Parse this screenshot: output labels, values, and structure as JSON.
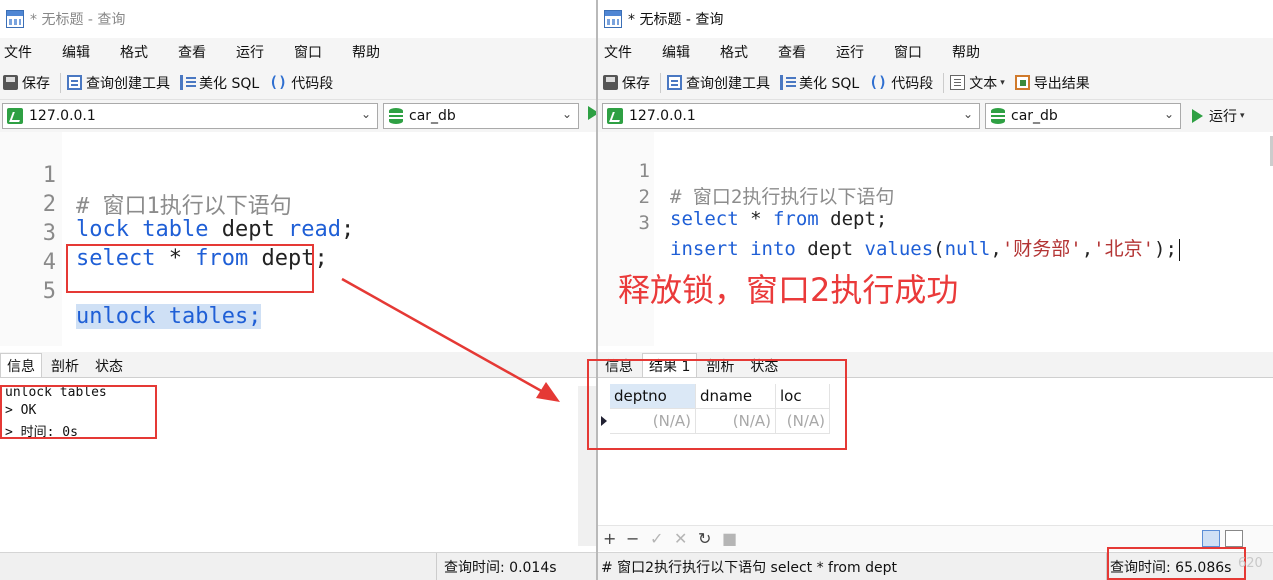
{
  "left": {
    "title": "* 无标题 - 查询",
    "menu": [
      "文件",
      "编辑",
      "格式",
      "查看",
      "运行",
      "窗口",
      "帮助"
    ],
    "toolbar": {
      "save": "保存",
      "query_builder": "查询创建工具",
      "beautify": "美化 SQL",
      "snippet_glyph": "()",
      "snippet": "代码段"
    },
    "connection": "127.0.0.1",
    "database": "car_db",
    "code_lines": [
      {
        "no": "1",
        "text": "# 窗口1执行以下语句"
      },
      {
        "no": "2",
        "kw1": "lock",
        "kw2": "table",
        "rest": " dept ",
        "kw3": "read",
        "end": ";"
      },
      {
        "no": "3",
        "kw1": "select",
        "mid": " * ",
        "kw2": "from",
        "rest": " dept;"
      },
      {
        "no": "4"
      },
      {
        "no": "5",
        "text": "unlock tables;"
      }
    ],
    "tabs": [
      "信息",
      "剖析",
      "状态"
    ],
    "messages": [
      "unlock tables",
      "> OK",
      "> 时间: 0s"
    ],
    "status_query_time": "查询时间: 0.014s"
  },
  "right": {
    "title": "* 无标题 - 查询",
    "menu": [
      "文件",
      "编辑",
      "格式",
      "查看",
      "运行",
      "窗口",
      "帮助"
    ],
    "toolbar": {
      "save": "保存",
      "query_builder": "查询创建工具",
      "beautify": "美化 SQL",
      "snippet_glyph": "()",
      "snippet": "代码段",
      "text": "文本",
      "export": "导出结果"
    },
    "connection": "127.0.0.1",
    "database": "car_db",
    "run": "运行",
    "code_lines": [
      {
        "no": "1",
        "text": "# 窗口2执行执行以下语句"
      },
      {
        "no": "2",
        "kw1": "select",
        "mid": " * ",
        "kw2": "from",
        "rest": " dept;"
      },
      {
        "no": "3",
        "kw1": "insert",
        "kw2": "into",
        "mid": " dept ",
        "kw3": "values",
        "p1": "(",
        "kw4": "null",
        "c1": ",",
        "s1": "'财务部'",
        "c2": ",",
        "s2": "'北京'",
        "end": ");"
      }
    ],
    "tabs": [
      "信息",
      "结果 1",
      "剖析",
      "状态"
    ],
    "grid": {
      "columns": [
        "deptno",
        "dname",
        "loc"
      ],
      "row": [
        "(N/A)",
        "(N/A)",
        "(N/A)"
      ]
    },
    "grid_toolbar": [
      "+",
      "−",
      "✓",
      "✕",
      "↻",
      "■"
    ],
    "status_sql": "# 窗口2执行执行以下语句 select * from dept",
    "status_query_time": "查询时间: 65.086s"
  },
  "annotation": "释放锁，窗口2执行成功",
  "watermark": "620",
  "colors": {
    "annotation": "#ea3a3a",
    "keyword": "#1f5fd6",
    "comment": "#8c8c8c",
    "string": "#b33434"
  }
}
